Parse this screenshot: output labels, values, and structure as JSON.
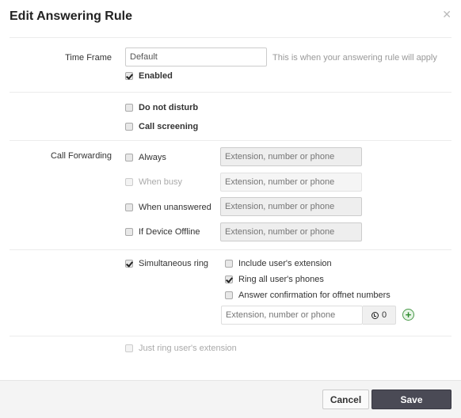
{
  "dialog": {
    "title": "Edit Answering Rule",
    "close_icon": "close-icon"
  },
  "time_frame": {
    "label": "Time Frame",
    "value": "Default",
    "hint": "This is when your answering rule will apply",
    "enabled_label": "Enabled",
    "enabled_checked": true
  },
  "options": {
    "do_not_disturb": {
      "label": "Do not disturb",
      "checked": false
    },
    "call_screening": {
      "label": "Call screening",
      "checked": false
    }
  },
  "call_forwarding": {
    "label": "Call Forwarding",
    "rows": [
      {
        "label": "Always",
        "checked": false,
        "disabled": false,
        "placeholder": "Extension, number or phone"
      },
      {
        "label": "When busy",
        "checked": false,
        "disabled": true,
        "placeholder": "Extension, number or phone"
      },
      {
        "label": "When unanswered",
        "checked": false,
        "disabled": false,
        "placeholder": "Extension, number or phone"
      },
      {
        "label": "If Device Offline",
        "checked": false,
        "disabled": false,
        "placeholder": "Extension, number or phone"
      }
    ]
  },
  "simultaneous_ring": {
    "label": "Simultaneous ring",
    "checked": true,
    "include_extension": {
      "label": "Include user's extension",
      "checked": false
    },
    "ring_all_phones": {
      "label": "Ring all user's phones",
      "checked": true
    },
    "answer_confirmation": {
      "label": "Answer confirmation for offnet numbers",
      "checked": false
    },
    "number_placeholder": "Extension, number or phone",
    "timer_value": "0",
    "timer_icon": "clock-icon",
    "add_icon": "plus-circle-icon"
  },
  "just_ring": {
    "label": "Just ring user's extension",
    "checked": false,
    "disabled": true
  },
  "footer": {
    "cancel_label": "Cancel",
    "save_label": "Save"
  }
}
